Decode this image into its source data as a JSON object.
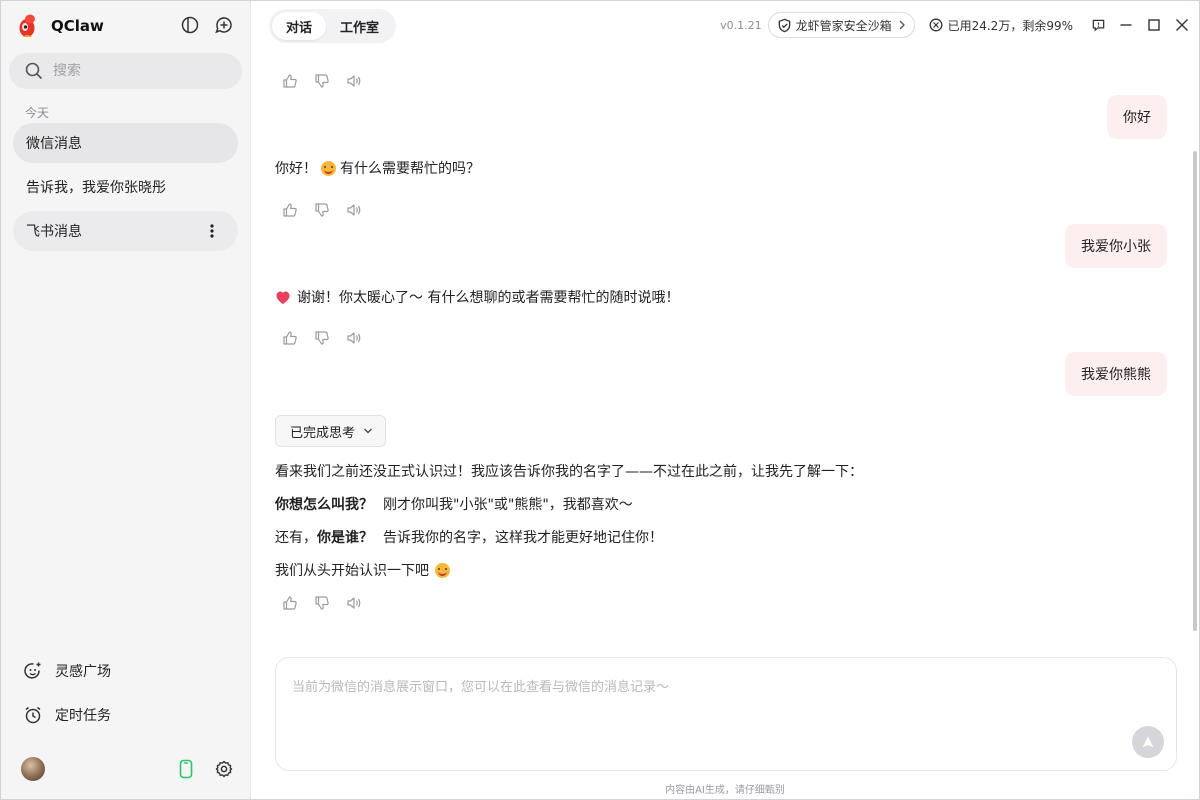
{
  "app": {
    "name": "QClaw",
    "version": "v0.1.21"
  },
  "sidebar": {
    "search_placeholder": "搜索",
    "section_today": "今天",
    "conversations": [
      {
        "label": "微信消息"
      },
      {
        "label": "告诉我，我爱你张晓彤"
      },
      {
        "label": "飞书消息"
      }
    ],
    "bottom": {
      "inspiration": "灵感广场",
      "scheduled": "定时任务"
    }
  },
  "header": {
    "tabs": [
      {
        "label": "对话"
      },
      {
        "label": "工作室"
      }
    ],
    "sandbox_label": "龙虾管家安全沙箱",
    "usage_label": "已用24.2万，剩余99%"
  },
  "messages": {
    "user_1": "你好",
    "bot_1_a": "你好！",
    "bot_1_b": "有什么需要帮忙的吗？",
    "user_2": "我爱你小张",
    "bot_2": "谢谢！你太暖心了～ 有什么想聊的或者需要帮忙的随时说哦！",
    "user_3": "我爱你熊熊",
    "thinking_label": "已完成思考",
    "bot_3_line1": "看来我们之前还没正式认识过！我应该告诉你我的名字了——不过在此之前，让我先了解一下：",
    "bot_3_line2_bold": "你想怎么叫我？",
    "bot_3_line2_rest": "刚才你叫我\"小张\"或\"熊熊\"，我都喜欢～",
    "bot_3_line3_pre": "还有，",
    "bot_3_line3_bold": "你是谁？",
    "bot_3_line3_rest": "告诉我你的名字，这样我才能更好地记住你！",
    "bot_3_line4": "我们从头开始认识一下吧"
  },
  "composer": {
    "placeholder": "当前为微信的消息展示窗口，您可以在此查看与微信的消息记录～"
  },
  "footer": {
    "disclaimer": "内容由AI生成，请仔细甄别"
  },
  "colors": {
    "user_bubble": "#fdefef",
    "accent": "#e5332a",
    "device": "#2bc46a"
  }
}
